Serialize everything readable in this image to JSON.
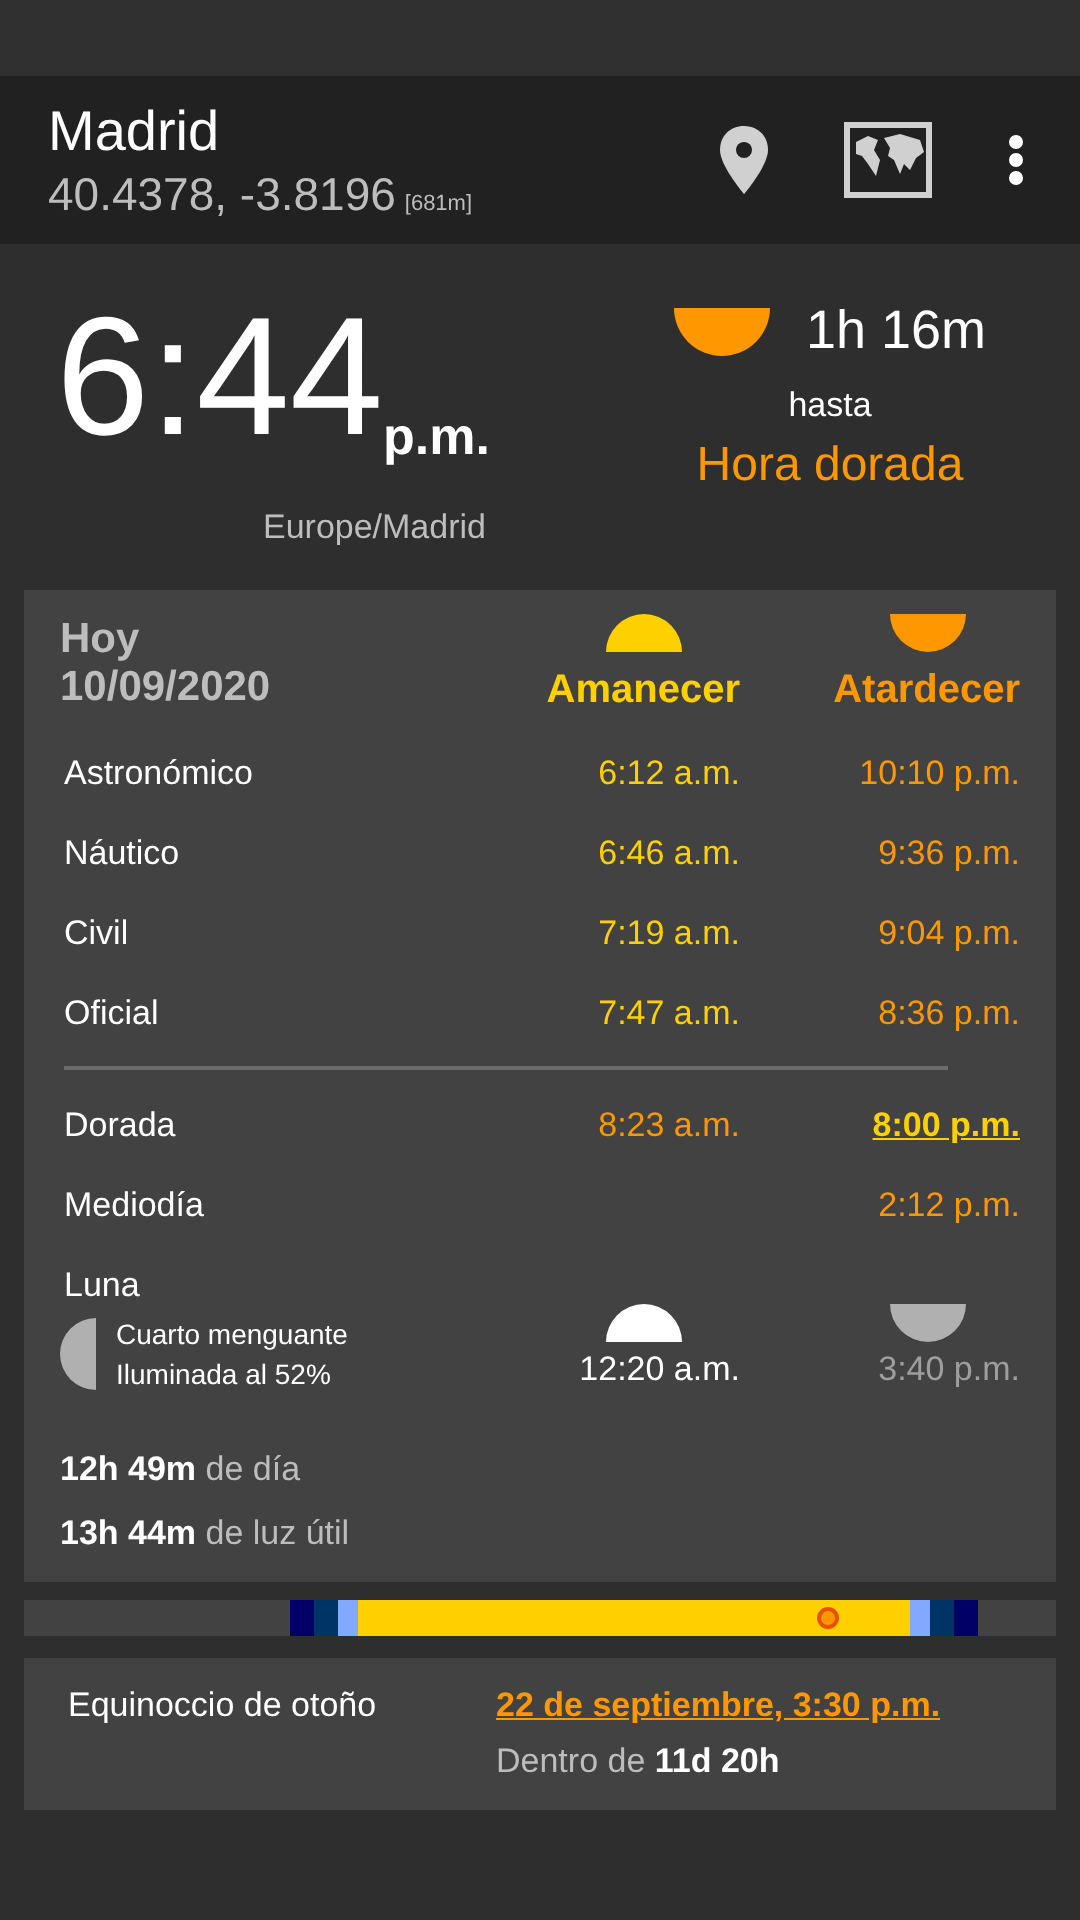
{
  "location": {
    "name": "Madrid",
    "coords": "40.4378, -3.8196",
    "elevation": "[681m]"
  },
  "clock": {
    "time": "6:44",
    "period": "p.m.",
    "timezone": "Europe/Madrid"
  },
  "countdown": {
    "duration": "1h 16m",
    "connector": "hasta",
    "event": "Hora dorada"
  },
  "today": {
    "label": "Hoy",
    "date": "10/09/2020",
    "columns": [
      {
        "label": "Amanecer",
        "kind": "rise"
      },
      {
        "label": "Atardecer",
        "kind": "set"
      }
    ]
  },
  "rows": [
    {
      "name": "Astronómico",
      "kind": "twilight",
      "rise": {
        "time": "6:12 a.m.",
        "next": false
      },
      "set": {
        "time": "10:10 p.m.",
        "next": false
      }
    },
    {
      "name": "Náutico",
      "kind": "twilight",
      "rise": {
        "time": "6:46 a.m.",
        "next": false
      },
      "set": {
        "time": "9:36 p.m.",
        "next": false
      }
    },
    {
      "name": "Civil",
      "kind": "twilight",
      "rise": {
        "time": "7:19 a.m.",
        "next": false
      },
      "set": {
        "time": "9:04 p.m.",
        "next": false
      }
    },
    {
      "name": "Oficial",
      "kind": "twilight",
      "rise": {
        "time": "7:47 a.m.",
        "next": false
      },
      "set": {
        "time": "8:36 p.m.",
        "next": false
      }
    },
    {
      "name": "Dorada",
      "kind": "golden",
      "rise": {
        "time": "8:23 a.m.",
        "next": false
      },
      "set": {
        "time": "8:00 p.m.",
        "next": true
      }
    },
    {
      "name": "Mediodía",
      "kind": "golden",
      "set": {
        "time": "2:12 p.m.",
        "next": false
      }
    }
  ],
  "moon": {
    "label": "Luna",
    "phase": "Cuarto menguante",
    "illumination": "Iluminada al 52%",
    "rise": "12:20 a.m.",
    "set": "3:40 p.m."
  },
  "day_lengths": [
    "**12h 49m** de día",
    "**13h 44m** de luz útil"
  ],
  "equinox": {
    "name": "Equinoccio de otoño",
    "date": "22 de septiembre, 3:30 p.m.",
    "countdown": "Dentro de **11d 20h**"
  }
}
